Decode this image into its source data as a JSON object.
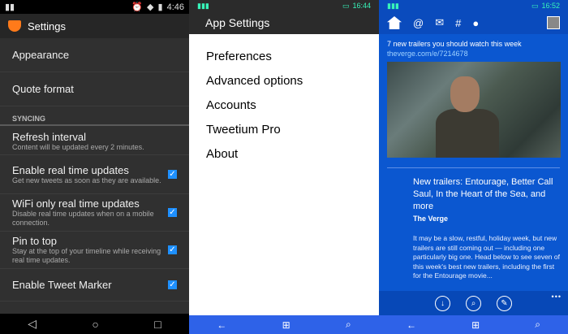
{
  "panel1": {
    "status": {
      "time": "4:46"
    },
    "title": "Settings",
    "items": {
      "appearance": "Appearance",
      "quote": "Quote format",
      "section": "SYNCING",
      "refresh_title": "Refresh interval",
      "refresh_sub": "Content will be updated every 2 minutes.",
      "realtime_title": "Enable real time updates",
      "realtime_sub": "Get new tweets as soon as they are available.",
      "wifi_title": "WiFi only real time updates",
      "wifi_sub": "Disable real time updates when on a mobile connection.",
      "pin_title": "Pin to top",
      "pin_sub": "Stay at the top of your timeline while receiving real time updates.",
      "marker_title": "Enable Tweet Marker"
    },
    "check": "✓",
    "nav": {
      "back": "◁",
      "home": "○",
      "recent": "□"
    }
  },
  "panel2": {
    "status": {
      "time": "16:44"
    },
    "title": "App Settings",
    "menu": [
      "Preferences",
      "Advanced options",
      "Accounts",
      "Tweetium Pro",
      "About"
    ],
    "nav": {
      "back": "←",
      "home": "⊞",
      "search": "⌕"
    }
  },
  "panel3": {
    "status": {
      "time": "16:52"
    },
    "tabs": {
      "mentions": "@",
      "messages": "✉",
      "hashtag": "#",
      "profile": "●"
    },
    "tweet_text": "7 new trailers you should watch this week",
    "tweet_link": "theverge.com/e/7214678",
    "card_title": "New trailers: Entourage, Better Call Saul, In the Heart of the Sea, and more",
    "card_source": "The Verge",
    "card_body": "It may be a slow, restful, holiday week, but new trailers are still coming out — including one particularly big one. Head below to see seven of this week's best new trailers, including the first for the Entourage movie...",
    "more": "•••",
    "actions": {
      "download": "↓",
      "search": "⌕",
      "edit": "✎"
    },
    "nav": {
      "back": "←",
      "home": "⊞",
      "search": "⌕"
    }
  }
}
